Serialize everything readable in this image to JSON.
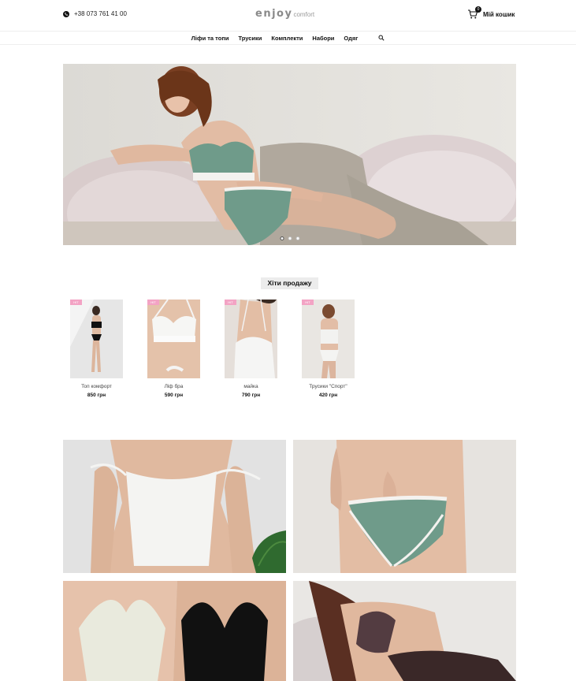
{
  "header": {
    "phone": "+38 073 761 41 00",
    "logo_main": "enjoy",
    "logo_sub": "comfort",
    "cart_label": "Мій кошик",
    "cart_count": "0"
  },
  "nav": {
    "items": [
      "Ліфи та топи",
      "Трусики",
      "Комплекти",
      "Набори",
      "Одяг"
    ]
  },
  "hero": {
    "slides": 3,
    "active_slide": 1
  },
  "bestsellers": {
    "title": "Хіти продажу",
    "products": [
      {
        "badge": "HIT",
        "name": "Топ комфорт",
        "price": "850 грн"
      },
      {
        "badge": "HIT",
        "name": "Ліф бра",
        "price": "590 грн"
      },
      {
        "badge": "HIT",
        "name": "майка",
        "price": "790 грн"
      },
      {
        "badge": "HIT",
        "name": "Трусики \"Спорт\"",
        "price": "420 грн"
      }
    ]
  },
  "colors": {
    "accent_green": "#6f9b8a",
    "badge_pink": "#f3a3c4",
    "text_dark": "#111111"
  }
}
